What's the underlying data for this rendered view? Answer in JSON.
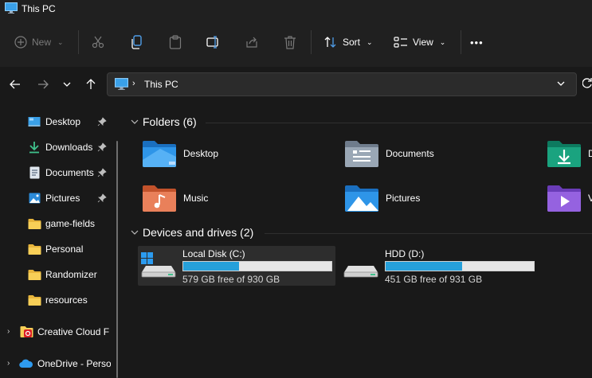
{
  "window": {
    "title": "This PC"
  },
  "toolbar": {
    "new_label": "New",
    "sort_label": "Sort",
    "view_label": "View",
    "more_label": "•••"
  },
  "address": {
    "separator": "›",
    "location": "This PC"
  },
  "sidebar": {
    "quick_access": [
      {
        "label": "Desktop",
        "icon": "desktop-icon",
        "pinned": true
      },
      {
        "label": "Downloads",
        "icon": "download-icon",
        "pinned": true
      },
      {
        "label": "Documents",
        "icon": "documents-icon",
        "pinned": true
      },
      {
        "label": "Pictures",
        "icon": "pictures-icon",
        "pinned": true
      },
      {
        "label": "game-fields",
        "icon": "folder-icon",
        "pinned": false
      },
      {
        "label": "Personal",
        "icon": "folder-icon",
        "pinned": false
      },
      {
        "label": "Randomizer",
        "icon": "folder-icon",
        "pinned": false
      },
      {
        "label": "resources",
        "icon": "folder-icon",
        "pinned": false
      }
    ],
    "creative_cloud": "Creative Cloud F",
    "onedrive": "OneDrive - Perso"
  },
  "folders": {
    "heading": "Folders (6)",
    "items": [
      {
        "label": "Desktop",
        "icon": "desktop-folder-icon"
      },
      {
        "label": "Documents",
        "icon": "documents-folder-icon"
      },
      {
        "label": "D",
        "icon": "downloads-folder-icon"
      },
      {
        "label": "Music",
        "icon": "music-folder-icon"
      },
      {
        "label": "Pictures",
        "icon": "pictures-folder-icon"
      },
      {
        "label": "V",
        "icon": "videos-folder-icon"
      }
    ]
  },
  "drives": {
    "heading": "Devices and drives (2)",
    "items": [
      {
        "name": "Local Disk (C:)",
        "free_text": "579 GB free of 930 GB",
        "used_fraction": 0.377,
        "selected": true
      },
      {
        "name": "HDD (D:)",
        "free_text": "451 GB free of 931 GB",
        "used_fraction": 0.516,
        "selected": false
      }
    ]
  },
  "colors": {
    "accent": "#26a0da",
    "background": "#191919",
    "toolbar": "#202020",
    "selected": "#2d2d2d"
  }
}
